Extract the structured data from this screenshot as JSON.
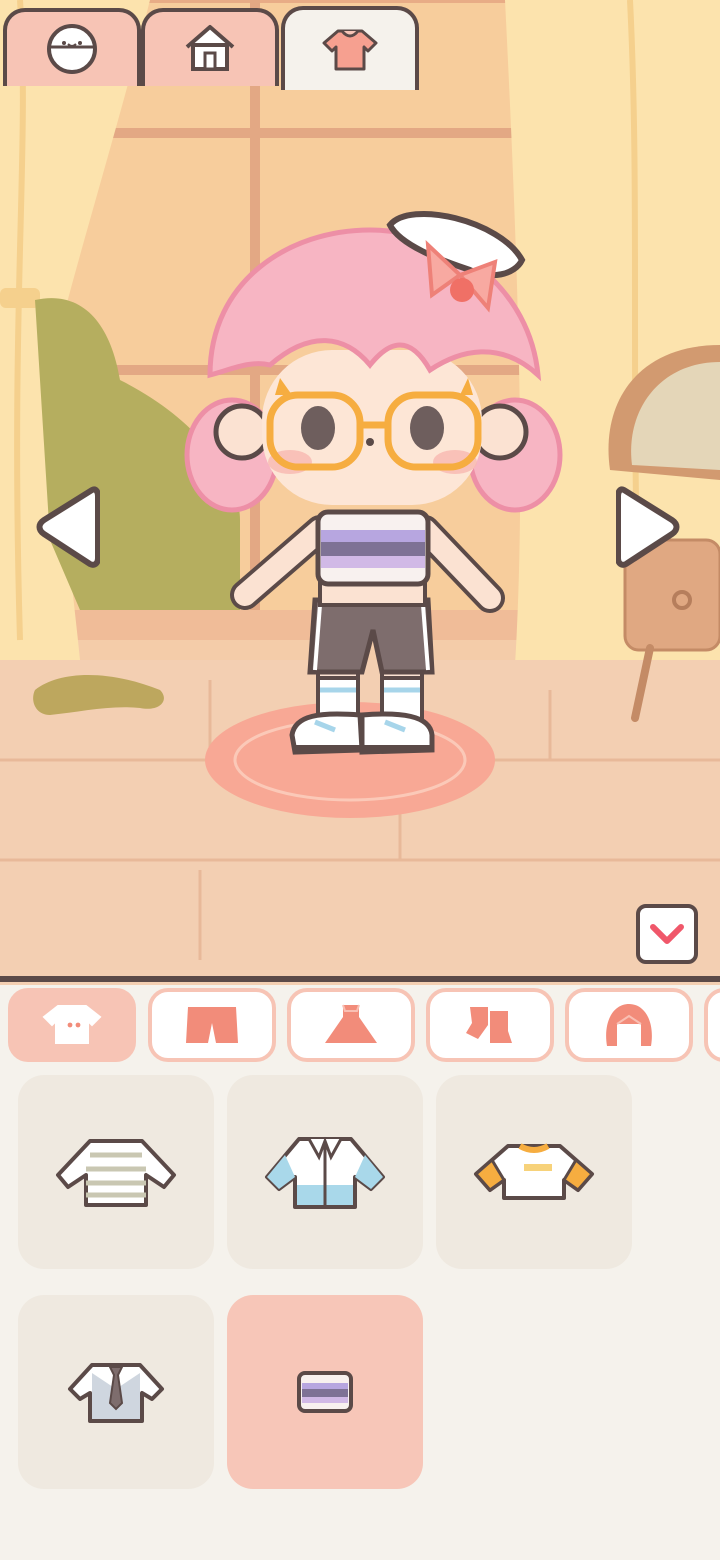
{
  "scene": {
    "colors": {
      "wall": "#f4c9a4",
      "window_sky": "#f7ce9c",
      "curtain": "#fbe4ae",
      "floor": "#f3cfb2",
      "rug": "#f8a893",
      "armchair": "#b6ad5e",
      "vanity": "#d7a27b"
    },
    "character": {
      "hair_color": "#f7aebf",
      "glasses_color": "#f6ad40",
      "top_stripes": [
        "#f8f1ef",
        "#b7a6e0",
        "#7e7295",
        "#d1b9e6"
      ],
      "shorts_color": "#7e6d6d",
      "accessory": "white-hat-with-pink-bow"
    },
    "prev_icon": "triangle-left-icon",
    "next_icon": "triangle-right-icon"
  },
  "tabs": [
    {
      "icon": "face-icon",
      "active": false
    },
    {
      "icon": "house-icon",
      "active": false
    },
    {
      "icon": "shirt-icon",
      "active": true
    }
  ],
  "collapse_icon": "chevron-down-icon",
  "categories": [
    {
      "icon": "top-icon",
      "active": true
    },
    {
      "icon": "shorts-icon",
      "active": false
    },
    {
      "icon": "dress-icon",
      "active": false
    },
    {
      "icon": "socks-icon",
      "active": false
    },
    {
      "icon": "hair-icon",
      "active": false
    }
  ],
  "items": [
    {
      "icon": "striped-sweater-icon",
      "selected": false
    },
    {
      "icon": "denim-jacket-icon",
      "selected": false
    },
    {
      "icon": "yellow-sleeve-shirt-icon",
      "selected": false
    },
    {
      "icon": "vest-with-tie-icon",
      "selected": false
    },
    {
      "icon": "striped-crop-top-icon",
      "selected": true
    }
  ],
  "accent_color": "#f28c7a",
  "outline_color": "#5b4a48"
}
